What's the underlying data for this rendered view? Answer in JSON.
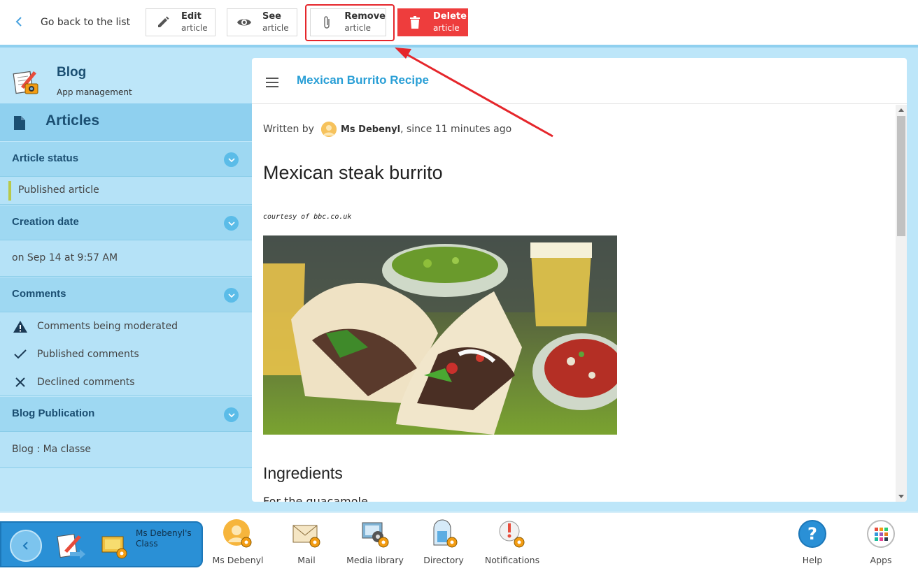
{
  "toolbar": {
    "back_label": "Go back to the list",
    "edit": {
      "line1": "Edit",
      "line2": "article"
    },
    "see": {
      "line1": "See",
      "line2": "article"
    },
    "remove": {
      "line1": "Remove",
      "line2": "article"
    },
    "delete": {
      "line1": "Delete",
      "line2": "article"
    }
  },
  "app": {
    "title": "Blog",
    "subtitle": "App management"
  },
  "sidebar": {
    "articles_label": "Articles",
    "article_status": {
      "heading": "Article status",
      "value": "Published article"
    },
    "creation_date": {
      "heading": "Creation date",
      "value": "on Sep 14 at 9:57 AM"
    },
    "comments": {
      "heading": "Comments",
      "items": [
        {
          "label": "Comments being moderated",
          "icon": "warning-icon"
        },
        {
          "label": "Published comments",
          "icon": "check-icon"
        },
        {
          "label": "Declined comments",
          "icon": "x-icon"
        }
      ]
    },
    "publication": {
      "heading": "Blog Publication",
      "value": "Blog : Ma classe"
    }
  },
  "article": {
    "panel_title": "Mexican Burrito Recipe",
    "written_by": "Written by",
    "author": "Ms Debenyl",
    "since": ", since 11 minutes ago",
    "title": "Mexican steak burrito",
    "courtesy": "courtesy of bbc.co.uk",
    "section_heading": "Ingredients",
    "subsection": "For the guacamole"
  },
  "dock": {
    "class_name": "Ms Debenyl's Class",
    "items": [
      {
        "label": "Ms Debenyl",
        "icon": "profile-icon"
      },
      {
        "label": "Mail",
        "icon": "mail-icon"
      },
      {
        "label": "Media library",
        "icon": "media-library-icon"
      },
      {
        "label": "Directory",
        "icon": "directory-icon"
      },
      {
        "label": "Notifications",
        "icon": "notifications-icon"
      },
      {
        "label": "Help",
        "icon": "help-icon"
      },
      {
        "label": "Apps",
        "icon": "apps-icon"
      }
    ]
  },
  "colors": {
    "accent": "#2a9fd6",
    "sidebar": "#9ed8f2",
    "delete": "#ee3d3d",
    "highlight": "#e5262b"
  }
}
